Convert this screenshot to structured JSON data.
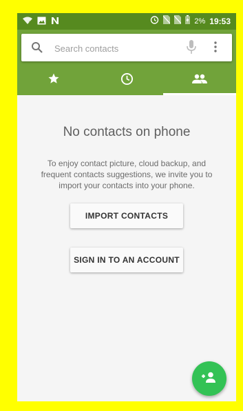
{
  "status_bar": {
    "battery_percent": "2%",
    "time": "19:53",
    "icons": [
      "wifi-icon",
      "image-icon",
      "n-icon",
      "alarm-icon",
      "no-sim-icon",
      "no-sim-icon",
      "battery-icon"
    ]
  },
  "search": {
    "placeholder": "Search contacts",
    "value": ""
  },
  "tabs": [
    {
      "icon": "star-icon",
      "active": false
    },
    {
      "icon": "clock-icon",
      "active": false
    },
    {
      "icon": "people-icon",
      "active": true
    }
  ],
  "main": {
    "title": "No contacts on phone",
    "description": "To enjoy contact picture, cloud backup, and frequent contacts suggestions, we invite you to import your contacts into your phone.",
    "import_button": "IMPORT CONTACTS",
    "signin_button": "SIGN IN TO AN ACCOUNT"
  },
  "fab": {
    "icon": "add-person-icon"
  },
  "colors": {
    "status_bar": "#568a1f",
    "header": "#71a33a",
    "fab": "#33c255",
    "frame": "#ffff00",
    "background": "#f5f5f5"
  }
}
